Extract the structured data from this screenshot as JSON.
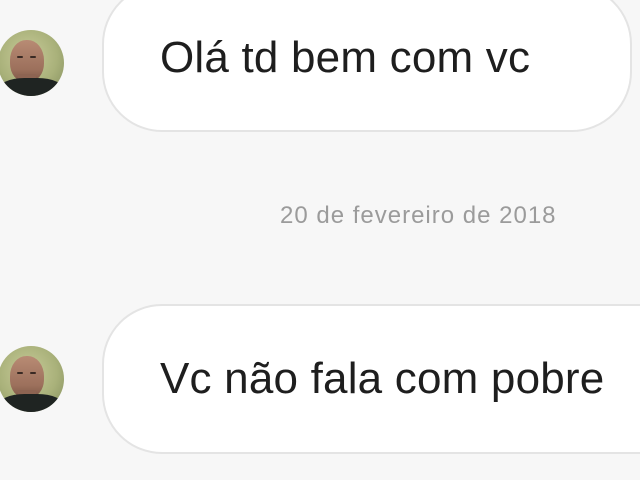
{
  "messages": [
    {
      "text": "Olá td bem com vc",
      "avatar_icon": "person-avatar-icon"
    },
    {
      "text": "Vc não fala com pobre",
      "avatar_icon": "person-avatar-icon"
    }
  ],
  "timestamp": "20 de fevereiro de 2018",
  "colors": {
    "background": "#f7f7f7",
    "bubble": "#ffffff",
    "bubble_border": "#e4e4e4",
    "text": "#1e1e1e",
    "timestamp": "#9b9b9b"
  }
}
